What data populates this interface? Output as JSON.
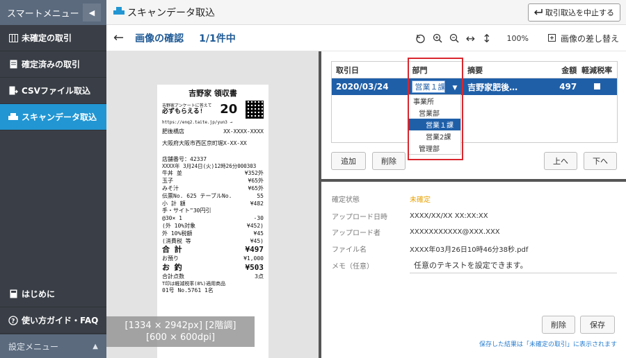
{
  "sidebar": {
    "header": "スマートメニュー",
    "items": [
      {
        "label": "未確定の取引",
        "icon": "columns-icon",
        "active": false
      },
      {
        "label": "確定済みの取引",
        "icon": "document-icon",
        "active": false
      },
      {
        "label": "CSVファイル取込",
        "icon": "import-icon",
        "active": false
      },
      {
        "label": "スキャンデータ取込",
        "icon": "scanner-icon",
        "active": true
      }
    ],
    "bottom_items": [
      {
        "label": "はじめに",
        "icon": "book-icon"
      },
      {
        "label": "使い方ガイド・FAQ",
        "icon": "help-icon"
      }
    ],
    "settings": "設定メニュー"
  },
  "topbar": {
    "title": "スキャンデータ取込",
    "stop_button": "取引取込を中止する"
  },
  "subbar": {
    "title": "画像の確認",
    "count": "1/1件中",
    "zoom": "100%",
    "replace": "画像の差し替え"
  },
  "receipt": {
    "shop": "吉野家 領収書",
    "promo1": "吉野家アンケートに答えて",
    "promo2": "必ずもらえる!",
    "promo_num": "20",
    "url": "https://enq2.taite.jp/yun3 →",
    "branch": "肥後橋店",
    "tel": "XX-XXXX-XXXX",
    "address": "大阪府大阪市西区京町堀X-XX-XX",
    "store_no": "店舗番号：42337",
    "datetime": "XXXX年 3月24日(火)12時26分000303",
    "lines": [
      [
        "牛丼 並",
        "¥352外"
      ],
      [
        "玉子",
        "¥65外"
      ],
      [
        "みそ汁",
        "¥65外"
      ],
      [
        "伝票No. 625 テーブルNo.",
        "55"
      ],
      [
        "小 計 額",
        "¥482"
      ],
      [
        "手・サイト\"30円引",
        ""
      ],
      [
        "@30× 1",
        "-30"
      ],
      [
        "(外 10%対象",
        "¥452)"
      ],
      [
        "外 10%税額",
        "¥45"
      ],
      [
        "(消費税 等",
        "¥45)"
      ],
      [
        "合 計",
        "¥497"
      ],
      [
        "お預り",
        "¥1,000"
      ],
      [
        "お 釣",
        "¥503"
      ],
      [
        "合計点数",
        "3点"
      ]
    ],
    "footnote": "T印は軽減税率(8%)適用商品",
    "footer": "01号 No.5761 1名",
    "badge1": "[1334 × 2942px] [2階調]",
    "badge2": "[600 × 600dpi]"
  },
  "table": {
    "headers": [
      "取引日",
      "部門",
      "摘要",
      "金額",
      "軽減税率"
    ],
    "row": {
      "date": "2020/03/24",
      "dept": "営業１課",
      "desc": "吉野家肥後…",
      "amount": "497"
    }
  },
  "dropdown": {
    "options": [
      {
        "label": "事業所",
        "level": 1,
        "selected": false
      },
      {
        "label": "営業部",
        "level": 2,
        "selected": false
      },
      {
        "label": "営業１課",
        "level": 3,
        "selected": true
      },
      {
        "label": "営業2課",
        "level": 3,
        "selected": false
      },
      {
        "label": "管理部",
        "level": 2,
        "selected": false
      }
    ]
  },
  "buttons": {
    "add": "追加",
    "delete": "削除",
    "up": "上へ",
    "down": "下へ",
    "delete2": "削除",
    "save": "保存"
  },
  "details": {
    "status_label": "確定状態",
    "status_value": "未確定",
    "upload_date_label": "アップロード日時",
    "upload_date_value": "XXXX/XX/XX XX:XX:XX",
    "uploader_label": "アップロード者",
    "uploader_value": "XXXXXXXXXXX@XXX.XXX",
    "file_label": "ファイル名",
    "file_value": "XXXX年03月26日10時46分38秒.pdf",
    "memo_label": "メモ（任意）",
    "memo_value": "任意のテキストを設定できます。"
  },
  "note": "保存した結果は「未確定の取引」に表示されます",
  "colors": {
    "accent": "#2196d3",
    "selected_row": "#1f5fa8",
    "warning": "#e8a200",
    "highlight_frame": "#d9262d"
  }
}
